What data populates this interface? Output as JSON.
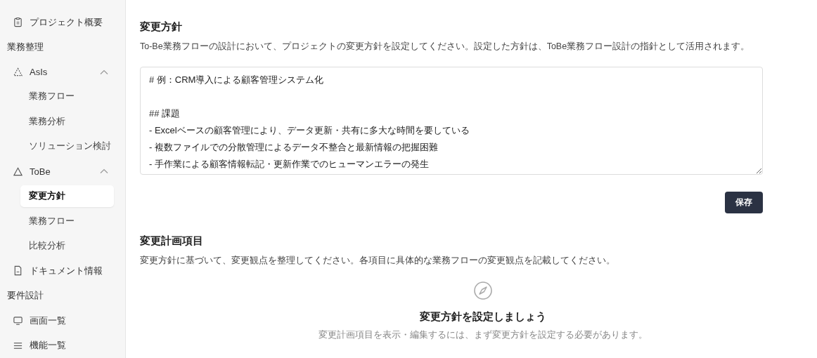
{
  "sidebar": [
    {
      "kind": "item",
      "label": "プロジェクト概要",
      "selected": false
    },
    {
      "kind": "section",
      "label": "業務整理"
    },
    {
      "kind": "group",
      "label": "AsIs",
      "expanded": true,
      "children": [
        {
          "label": "業務フロー",
          "selected": false
        },
        {
          "label": "業務分析",
          "selected": false
        },
        {
          "label": "ソリューション検討",
          "selected": false
        }
      ]
    },
    {
      "kind": "group",
      "label": "ToBe",
      "expanded": true,
      "children": [
        {
          "label": "変更方針",
          "selected": true
        },
        {
          "label": "業務フロー",
          "selected": false
        },
        {
          "label": "比較分析",
          "selected": false
        }
      ]
    },
    {
      "kind": "item",
      "label": "ドキュメント情報",
      "selected": false
    },
    {
      "kind": "section",
      "label": "要件設計"
    },
    {
      "kind": "item",
      "label": "画面一覧",
      "selected": false
    },
    {
      "kind": "item",
      "label": "機能一覧",
      "selected": false
    }
  ],
  "policy": {
    "title": "変更方針",
    "description": "To-Be業務フローの設計において、プロジェクトの変更方針を設定してください。設定した方針は、ToBe業務フロー設計の指針として活用されます。",
    "value": "# 例：CRM導入による顧客管理システム化\n\n## 課題\n- Excelベースの顧客管理により、データ更新・共有に多大な時間を要している\n- 複数ファイルでの分散管理によるデータ不整合と最新情報の把握困難\n- 手作業による顧客情報転記・更新作業でのヒューマンエラーの発生",
    "save_button": "保存"
  },
  "plan": {
    "title": "変更計画項目",
    "description": "変更方針に基づいて、変更観点を整理してください。各項目に具体的な業務フローの変更観点を記載してください。",
    "empty_title": "変更方針を設定しましょう",
    "empty_text": "変更計画項目を表示・編集するには、まず変更方針を設定する必要があります。"
  }
}
